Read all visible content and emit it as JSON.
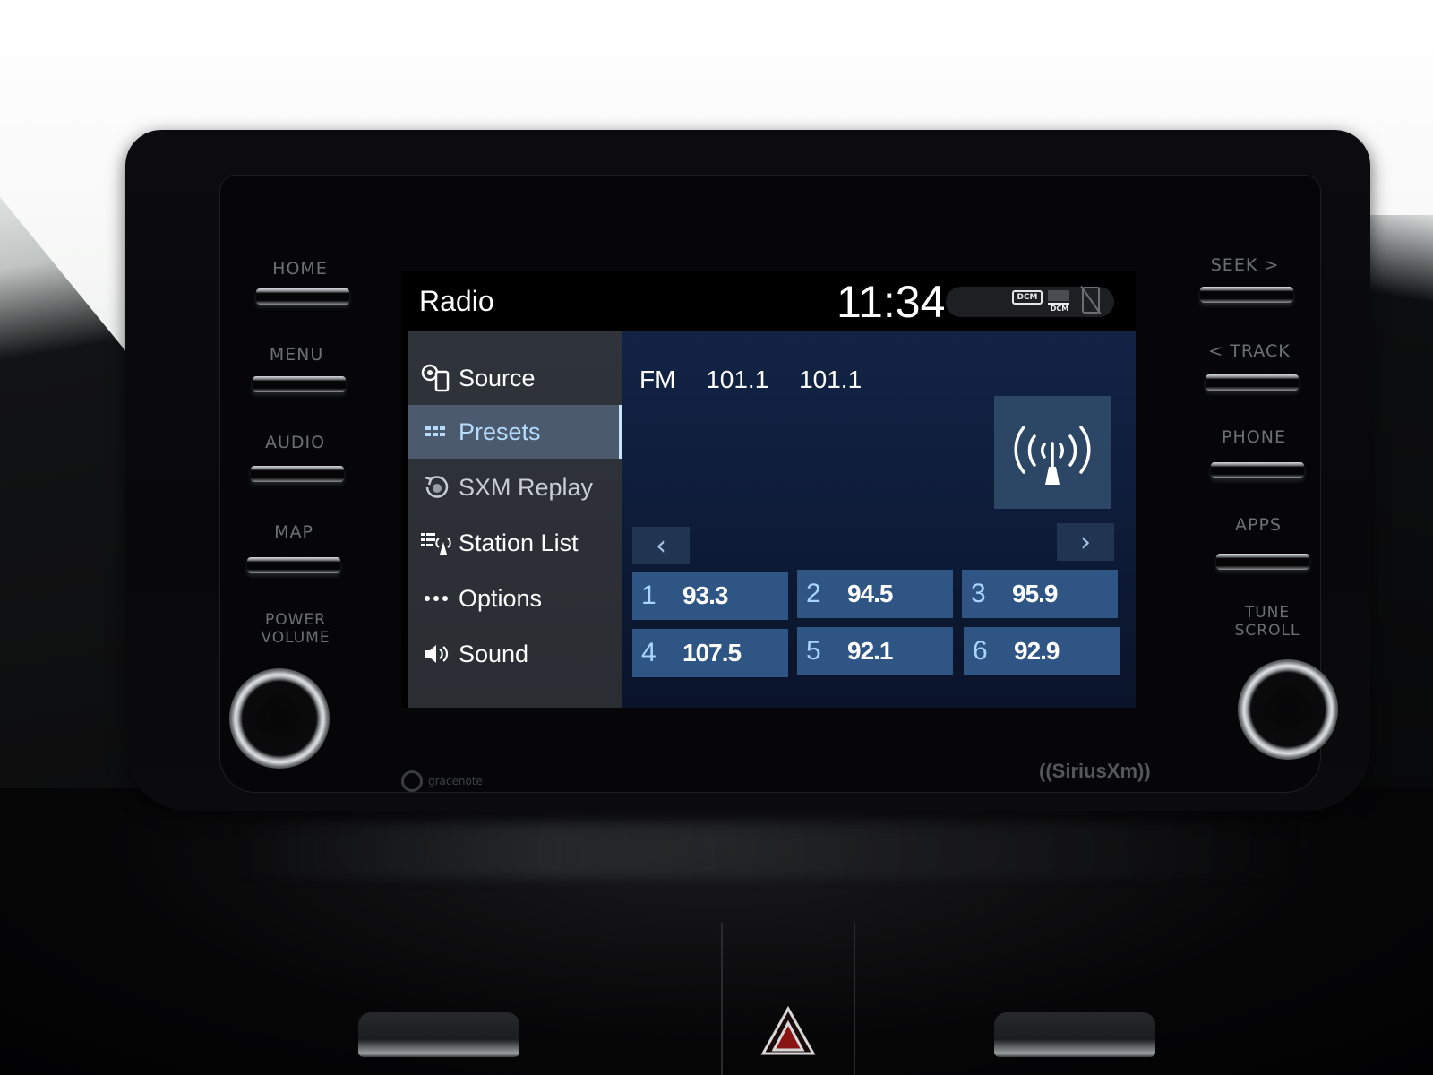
{
  "screen": {
    "title": "Radio",
    "clock": "11:34",
    "status_icons": {
      "dcm_label": "DCM",
      "dcm_signal_label": "DCM",
      "phone": "phone-disconnected-icon"
    }
  },
  "menu": {
    "items": [
      {
        "label": "Source",
        "icon": "source-icon",
        "active": false
      },
      {
        "label": "Presets",
        "icon": "presets-grid-icon",
        "active": true
      },
      {
        "label": "SXM Replay",
        "icon": "sxm-replay-icon",
        "active": false
      },
      {
        "label": "Station List",
        "icon": "station-list-icon",
        "active": false
      },
      {
        "label": "Options",
        "icon": "more-dots-icon",
        "active": false
      },
      {
        "label": "Sound",
        "icon": "speaker-icon",
        "active": false
      }
    ]
  },
  "now_playing": {
    "band": "FM",
    "frequency": "101.1",
    "station_name": "101.1",
    "art_icon": "radio-antenna-icon"
  },
  "preset_nav": {
    "prev": "‹",
    "next": "›"
  },
  "presets": [
    {
      "number": "1",
      "frequency": "93.3"
    },
    {
      "number": "2",
      "frequency": "94.5"
    },
    {
      "number": "3",
      "frequency": "95.9"
    },
    {
      "number": "4",
      "frequency": "107.5"
    },
    {
      "number": "5",
      "frequency": "92.1"
    },
    {
      "number": "6",
      "frequency": "92.9"
    }
  ],
  "hardware": {
    "left_buttons": [
      "HOME",
      "MENU",
      "AUDIO",
      "MAP"
    ],
    "left_knob_label_1": "POWER",
    "left_knob_label_2": "VOLUME",
    "right_buttons": [
      "SEEK >",
      "< TRACK",
      "PHONE",
      "APPS"
    ],
    "right_knob_label_1": "TUNE",
    "right_knob_label_2": "SCROLL"
  },
  "branding": {
    "gracenote": "gracenote",
    "siriusxm": "((SiriusXm))"
  },
  "colors": {
    "menu_active_bg": "#4b5a6d",
    "menu_active_text": "#b5dcff",
    "preset_bg": "#2f5585",
    "main_bg": "#122345"
  }
}
